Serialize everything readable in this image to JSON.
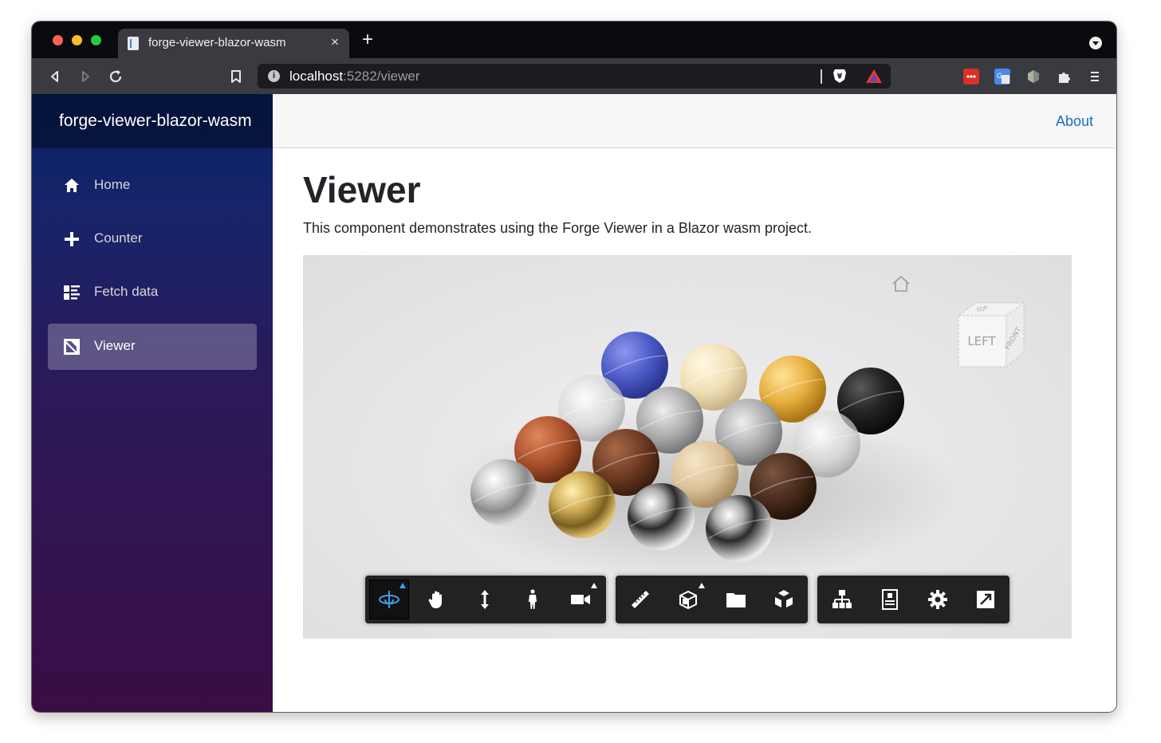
{
  "browser": {
    "tab_title": "forge-viewer-blazor-wasm",
    "tab_close": "×",
    "new_tab": "+",
    "address_host": "localhost",
    "address_rest": ":5282/viewer"
  },
  "app": {
    "brand": "forge-viewer-blazor-wasm",
    "nav": [
      {
        "label": "Home",
        "icon": "home-icon"
      },
      {
        "label": "Counter",
        "icon": "plus-icon"
      },
      {
        "label": "Fetch data",
        "icon": "list-icon"
      },
      {
        "label": "Viewer",
        "icon": "image-icon",
        "active": true
      }
    ],
    "top_link": "About"
  },
  "page": {
    "title": "Viewer",
    "description": "This component demonstrates using the Forge Viewer in a Blazor wasm project."
  },
  "viewer": {
    "viewcube_faces": {
      "top": "TOP",
      "left": "LEFT",
      "front": "FRONT"
    },
    "toolbar_groups": [
      [
        "orbit-icon",
        "pan-icon",
        "zoom-icon",
        "first-person-icon",
        "camera-icon"
      ],
      [
        "measure-icon",
        "section-icon",
        "model-browser-icon",
        "explode-icon"
      ],
      [
        "structure-icon",
        "properties-icon",
        "settings-icon",
        "fullscreen-icon"
      ]
    ]
  },
  "colors": {
    "sidebar_top": "#062263",
    "sidebar_bottom": "#3a0d45",
    "link": "#1b6ec2",
    "viewer_bg": "#e5e5e5",
    "toolbar_bg": "#222222",
    "active_tool": "#3aa0e4"
  }
}
